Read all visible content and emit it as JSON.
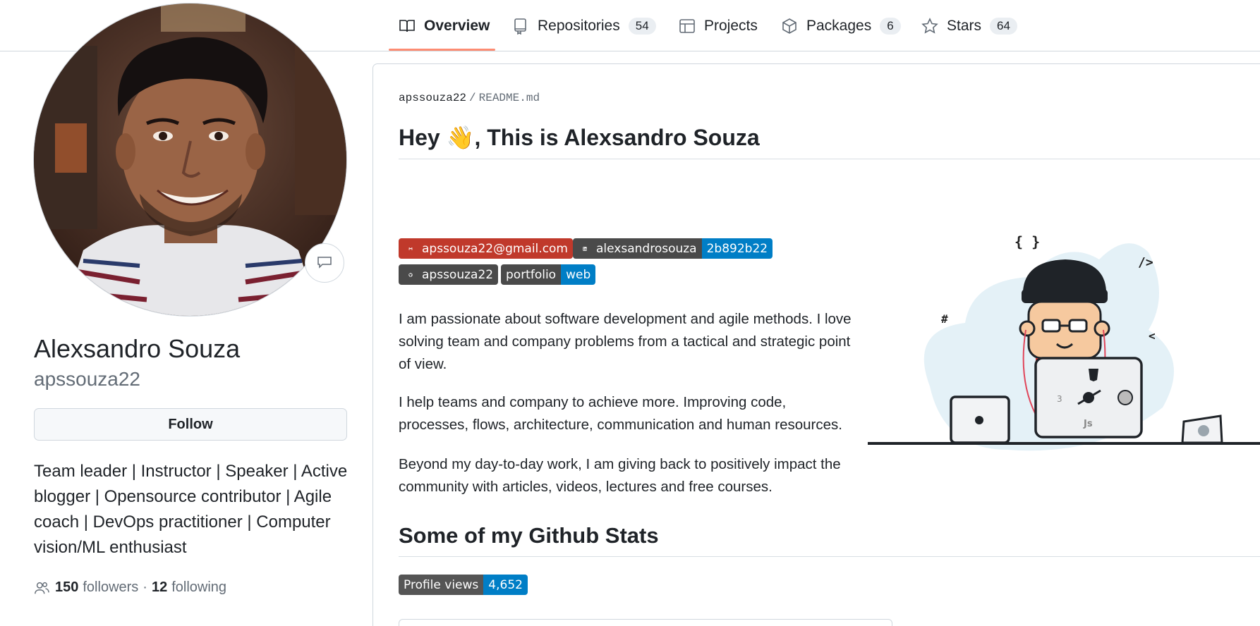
{
  "nav": {
    "tabs": [
      {
        "label": "Overview",
        "count": null,
        "icon": "book-icon"
      },
      {
        "label": "Repositories",
        "count": "54",
        "icon": "repo-icon"
      },
      {
        "label": "Projects",
        "count": null,
        "icon": "table-icon"
      },
      {
        "label": "Packages",
        "count": "6",
        "icon": "package-icon"
      },
      {
        "label": "Stars",
        "count": "64",
        "icon": "star-icon"
      }
    ],
    "active_tab": "Overview"
  },
  "profile": {
    "name": "Alexsandro Souza",
    "login": "apssouza22",
    "follow_label": "Follow",
    "bio": "Team leader | Instructor | Speaker | Active blogger | Opensource contributor | Agile coach | DevOps practitioner | Computer vision/ML enthusiast",
    "followers_count": "150",
    "followers_label": "followers",
    "dot": "·",
    "following_count": "12",
    "following_label": "following"
  },
  "readme": {
    "owner": "apssouza22",
    "separator": "/",
    "file": "README.md",
    "heading_prefix": "Hey",
    "heading_emoji": "👋",
    "heading_suffix": ", This is Alexsandro Souza",
    "badges": {
      "email": "apssouza22@gmail.com",
      "linkedin_label": "alexsandrosouza",
      "linkedin_value": "2b892b22",
      "github": "apssouza22",
      "portfolio_label": "portfolio",
      "portfolio_value": "web"
    },
    "paragraphs": [
      "I am passionate about software development and agile methods. I love solving team and company problems from a tactical and strategic point of view.",
      "I help teams and company to achieve more. Improving code, processes, flows, architecture, communication and human resources.",
      "Beyond my day-to-day work, I am giving back to positively impact the community with articles, videos, lectures and free courses."
    ],
    "stats_heading": "Some of my Github Stats",
    "views_badge": {
      "label": "Profile views",
      "value": "4,652"
    },
    "illustration": {
      "braces": "{ }",
      "tag": "/>",
      "hash": "#",
      "chevron": "<",
      "js": "Js"
    }
  },
  "colors": {
    "accent_underline": "#fd8c73",
    "gmail_red": "#c0392b",
    "linkedin_blue": "#0a66c2",
    "badge_blue": "#007ec6"
  }
}
